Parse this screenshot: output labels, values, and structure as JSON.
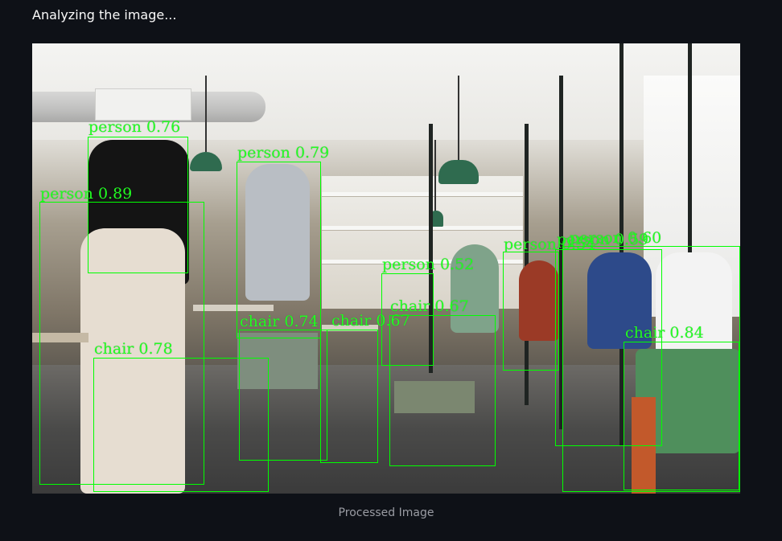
{
  "status_text": "Analyzing the image...",
  "caption": "Processed Image",
  "detection_color": "#00ff00",
  "detections": [
    {
      "label": "person 0.76"
    },
    {
      "label": "person 0.79"
    },
    {
      "label": "person 0.89"
    },
    {
      "label": "person 0.52"
    },
    {
      "label": "person 0.54"
    },
    {
      "label": "person 0.59"
    },
    {
      "label": "person 0.60"
    },
    {
      "label": "chair 0.78"
    },
    {
      "label": "chair 0.74"
    },
    {
      "label": "chair 0.67"
    },
    {
      "label": "chair 0.67"
    },
    {
      "label": "chair 0.84"
    }
  ]
}
